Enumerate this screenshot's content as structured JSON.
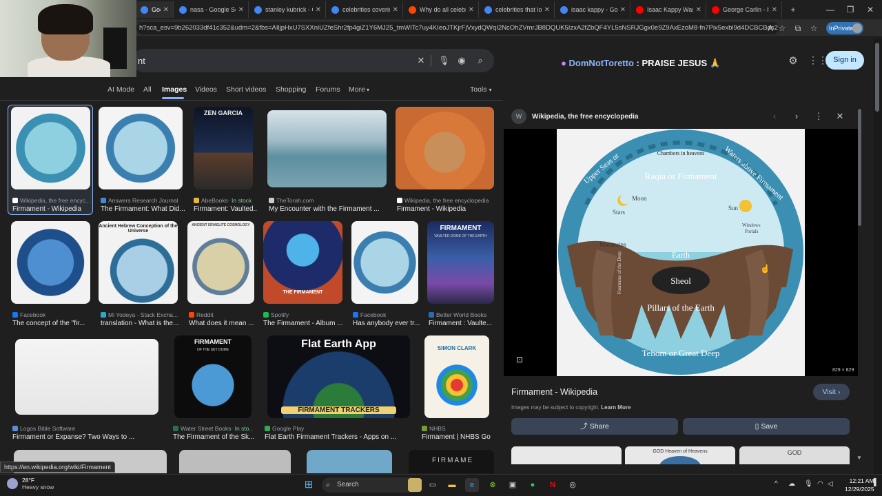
{
  "browser": {
    "tabs": [
      {
        "label": "Google",
        "color": "#4285f4",
        "active": true
      },
      {
        "label": "nasa - Google Search",
        "color": "#4285f4"
      },
      {
        "label": "stanley kubrick - Go",
        "color": "#4285f4"
      },
      {
        "label": "celebrities covering",
        "color": "#4285f4"
      },
      {
        "label": "Why do all celebritie",
        "color": "#ff4500"
      },
      {
        "label": "celebrities that look",
        "color": "#4285f4"
      },
      {
        "label": "isaac kappy - Google",
        "color": "#4285f4"
      },
      {
        "label": "Isaac Kappy Was RIG",
        "color": "#ff0000"
      },
      {
        "label": "George Carlin - It's A",
        "color": "#ff0000"
      }
    ],
    "url": "h?sca_esv=9b262033df41c352&udm=2&fbs=AIljpHxU7SXXniUZfeShr2fp4giZ1Y6MJ25_tmWITc7uy4KIeoJTKjrFjVxydQWqI2NcOhZVmrJB8DQUK5IzxA2fZbQF4YL5sNSRJGgx0e9Z9AxEzoM8-fn7Pix5exbl9d4DCBCBos2Yhq...",
    "inprivate": "InPrivate",
    "status_url": "https://en.wikipedia.org/wiki/Firmament"
  },
  "search": {
    "query": "nt",
    "banner_user": "DomNotToretto",
    "banner_text": ": PRAISE JESUS",
    "signin": "Sign in",
    "filters": [
      "AI Mode",
      "All",
      "Images",
      "Videos",
      "Short videos",
      "Shopping",
      "Forums",
      "More"
    ],
    "tools": "Tools"
  },
  "results": [
    {
      "src": "Wikipedia, the free encyc...",
      "title": "Firmament - Wikipedia",
      "color": "#ffffff"
    },
    {
      "src": "Answers Research Journal",
      "title": "The Firmament: What Did...",
      "color": "#3d8bd9"
    },
    {
      "src": "AbeBooks",
      "stock": " · In stock",
      "title": "Firmament: Vaulted...",
      "color": "#e4ba3b"
    },
    {
      "src": "TheTorah.com",
      "title": "My Encounter with the Firmament ...",
      "color": "#cccccc"
    },
    {
      "src": "Wikipedia, the free encyclopedia",
      "title": "Firmament - Wikipedia",
      "color": "#ffffff"
    },
    {
      "src": "Facebook",
      "title": "The concept of the \"fir...",
      "color": "#1877f2"
    },
    {
      "src": "Mi Yodeya - Stack Excha...",
      "title": "translation - What is the...",
      "color": "#2ba8c4"
    },
    {
      "src": "Reddit",
      "title": "What does it mean ...",
      "color": "#ff4500"
    },
    {
      "src": "Spotify",
      "title": "The Firmament - Album ...",
      "color": "#1db954"
    },
    {
      "src": "Facebook",
      "title": "Has anybody ever tr...",
      "color": "#1877f2"
    },
    {
      "src": "Better World Books",
      "title": "Firmament : Vaulte...",
      "color": "#2a6cb0"
    },
    {
      "src": "Logos Bible Software",
      "title": "Firmament or Expanse? Two Ways to ...",
      "color": "#5a8fd6"
    },
    {
      "src": "Water Street Books",
      "stock": " · In sto...",
      "title": "The Firmament of the Sk...",
      "color": "#2c6e49"
    },
    {
      "src": "Google Play",
      "title": "Flat Earth Firmament Trackers - Apps on ...",
      "color": "#34a853"
    },
    {
      "src": "NHBS",
      "title": "Firmament | NHBS Go...",
      "color": "#7a9a3a"
    }
  ],
  "thumb_text": {
    "zen_garcia": "ZEN GARCIA",
    "hebrew": "Ancient Hebrew Conception of the Universe",
    "israelite": "ANCIENT ISRAELITE COSMOLOGY",
    "album": "THE FIRMAMENT",
    "vaulted_title": "FIRMAMENT",
    "vaulted_sub": "VAULTED DOME OF THE EARTH",
    "sky_dome_title": "FIRMAMENT",
    "sky_dome_sub": "OF THE SKY DOME",
    "app_title": "Flat Earth App",
    "app_footer": "FIRMAMENT TRACKERS",
    "simon": "SIMON CLARK",
    "simon_book": "FIRMAMENT",
    "bottom_right": "FIRMAME"
  },
  "panel": {
    "site": "Wikipedia, the free encyclopedia",
    "site_fav": "W",
    "title": "Firmament - Wikipedia",
    "visit": "Visit",
    "copyright": "Images may be subject to copyright.",
    "learn_more": "Learn More",
    "share": "Share",
    "save": "Save",
    "size": "829 × 829",
    "diagram": {
      "chambers": "Chambers in heavens",
      "upper_seas": "Upper Seas or",
      "waters_above": "Waters above Firmament",
      "raqia": "Raqia or Firmament",
      "moon": "Moon",
      "stars": "Stars",
      "sun": "Sun",
      "windows": "Windows",
      "portals": "Portals",
      "mountains": "Mountains",
      "earth": "Earth",
      "fountains": "Fountains of the Deep",
      "sheol": "Sheol",
      "pillars": "Pillars of the Earth",
      "tehom": "Tehom or Great Deep"
    },
    "related": [
      "",
      "GOD Heaven of Heavens",
      "GOD"
    ]
  },
  "taskbar": {
    "temp": "28°F",
    "weather": "Heavy snow",
    "search": "Search",
    "time": "12:21 AM",
    "date": "12/29/2025"
  }
}
